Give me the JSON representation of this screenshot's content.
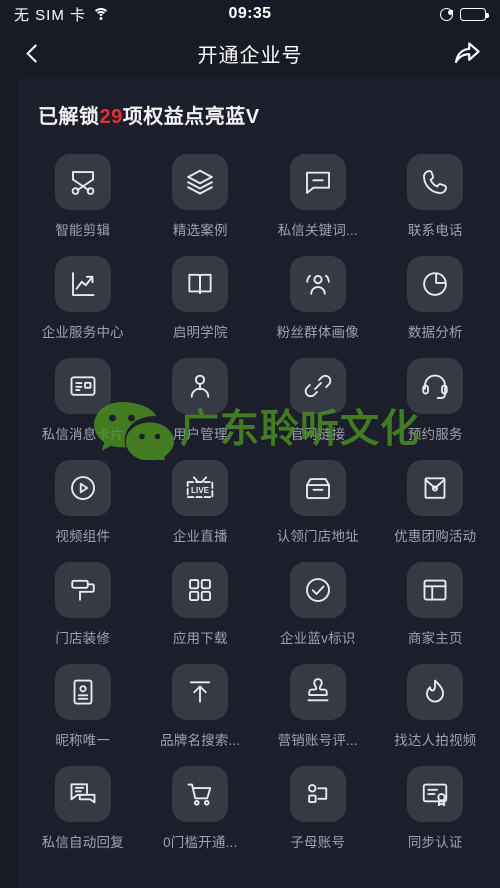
{
  "status_bar": {
    "carrier": "无 SIM 卡",
    "time": "09:35",
    "wifi_icon": "wifi-icon",
    "location_icon": "location-services-icon",
    "battery_icon": "battery-full-icon"
  },
  "nav": {
    "back_icon": "back-chevron-icon",
    "title": "开通企业号",
    "share_icon": "share-arrow-icon"
  },
  "heading": {
    "prefix": "已解锁",
    "count": "29",
    "suffix": "项权益点亮蓝V",
    "highlight_color": "#e2302e"
  },
  "watermark": {
    "logo_icon": "wechat-logo-icon",
    "text": "广东聆听文化",
    "color": "#4c9022"
  },
  "theme": {
    "background": "#181b25",
    "panel": "#1c1f2b",
    "tile": "#363a45",
    "label": "#9da2ad",
    "icon_stroke": "#e8eaee"
  },
  "benefits": [
    {
      "label": "智能剪辑",
      "icon": "scissors-icon"
    },
    {
      "label": "精选案例",
      "icon": "layers-icon"
    },
    {
      "label": "私信关键词...",
      "icon": "chat-bubble-minus-icon"
    },
    {
      "label": "联系电话",
      "icon": "phone-icon"
    },
    {
      "label": "企业服务中心",
      "icon": "line-chart-icon"
    },
    {
      "label": "启明学院",
      "icon": "open-book-icon"
    },
    {
      "label": "粉丝群体画像",
      "icon": "user-group-icon"
    },
    {
      "label": "数据分析",
      "icon": "pie-chart-icon"
    },
    {
      "label": "私信消息卡片",
      "icon": "id-card-icon"
    },
    {
      "label": "用户管理",
      "icon": "person-icon"
    },
    {
      "label": "官网链接",
      "icon": "link-icon"
    },
    {
      "label": "预约服务",
      "icon": "headset-icon"
    },
    {
      "label": "视频组件",
      "icon": "play-circle-icon"
    },
    {
      "label": "企业直播",
      "icon": "live-tv-icon"
    },
    {
      "label": "认领门店地址",
      "icon": "storefront-icon"
    },
    {
      "label": "优惠团购活动",
      "icon": "envelope-icon"
    },
    {
      "label": "门店装修",
      "icon": "paint-roller-icon"
    },
    {
      "label": "应用下载",
      "icon": "grid-squares-icon"
    },
    {
      "label": "企业蓝v标识",
      "icon": "check-circle-icon"
    },
    {
      "label": "商家主页",
      "icon": "layout-page-icon"
    },
    {
      "label": "昵称唯一",
      "icon": "id-badge-icon"
    },
    {
      "label": "品牌名搜索...",
      "icon": "arrow-up-bar-icon"
    },
    {
      "label": "营销账号评...",
      "icon": "stamp-icon"
    },
    {
      "label": "找达人拍视频",
      "icon": "flame-icon"
    },
    {
      "label": "私信自动回复",
      "icon": "chat-bubbles-icon"
    },
    {
      "label": "0门槛开通...",
      "icon": "shopping-cart-icon"
    },
    {
      "label": "子母账号",
      "icon": "node-hierarchy-icon"
    },
    {
      "label": "同步认证",
      "icon": "certificate-icon"
    }
  ]
}
